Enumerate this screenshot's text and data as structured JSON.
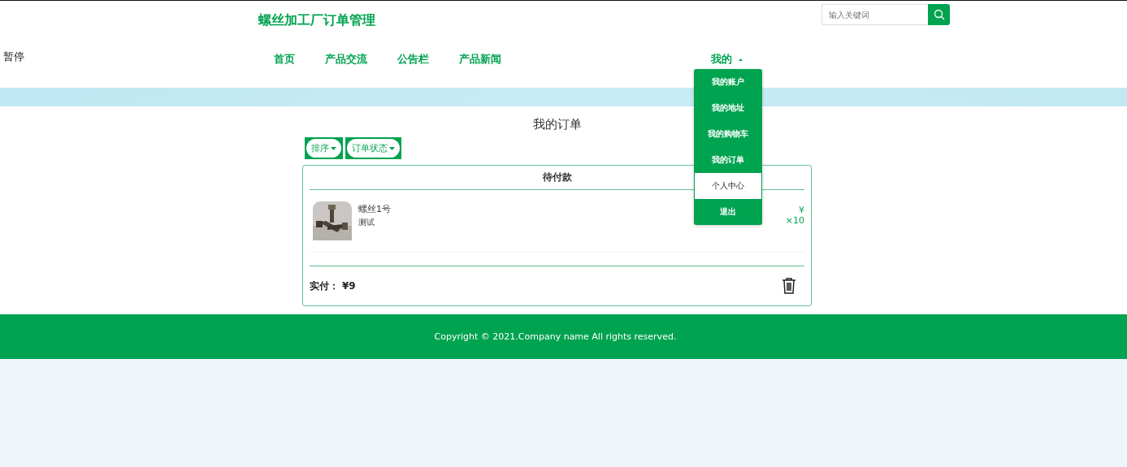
{
  "overlay_text": "暂停",
  "header": {
    "title": "螺丝加工厂订单管理",
    "search": {
      "placeholder": "输入关键词"
    }
  },
  "nav": {
    "items": [
      {
        "label": "首页"
      },
      {
        "label": "产品交流"
      },
      {
        "label": "公告栏"
      },
      {
        "label": "产品新闻"
      }
    ],
    "account": {
      "label": "我的",
      "expanded": true,
      "menu": [
        {
          "label": "我的账户",
          "selected": false
        },
        {
          "label": "我的地址",
          "selected": false
        },
        {
          "label": "我的购物车",
          "selected": false
        },
        {
          "label": "我的订单",
          "selected": false
        },
        {
          "label": "个人中心",
          "selected": true
        },
        {
          "label": "退出",
          "selected": false
        }
      ]
    }
  },
  "page_title": "我的订单",
  "filters": [
    {
      "label": "排序"
    },
    {
      "label": "订单状态"
    }
  ],
  "order": {
    "status": "待付款",
    "items": [
      {
        "name": "螺丝1号",
        "note": "测试",
        "price": "¥",
        "quantity": "×10"
      }
    ],
    "total_label": "实付：",
    "total": "¥9"
  },
  "footer": "Copyright © 2021.Company name All rights reserved."
}
